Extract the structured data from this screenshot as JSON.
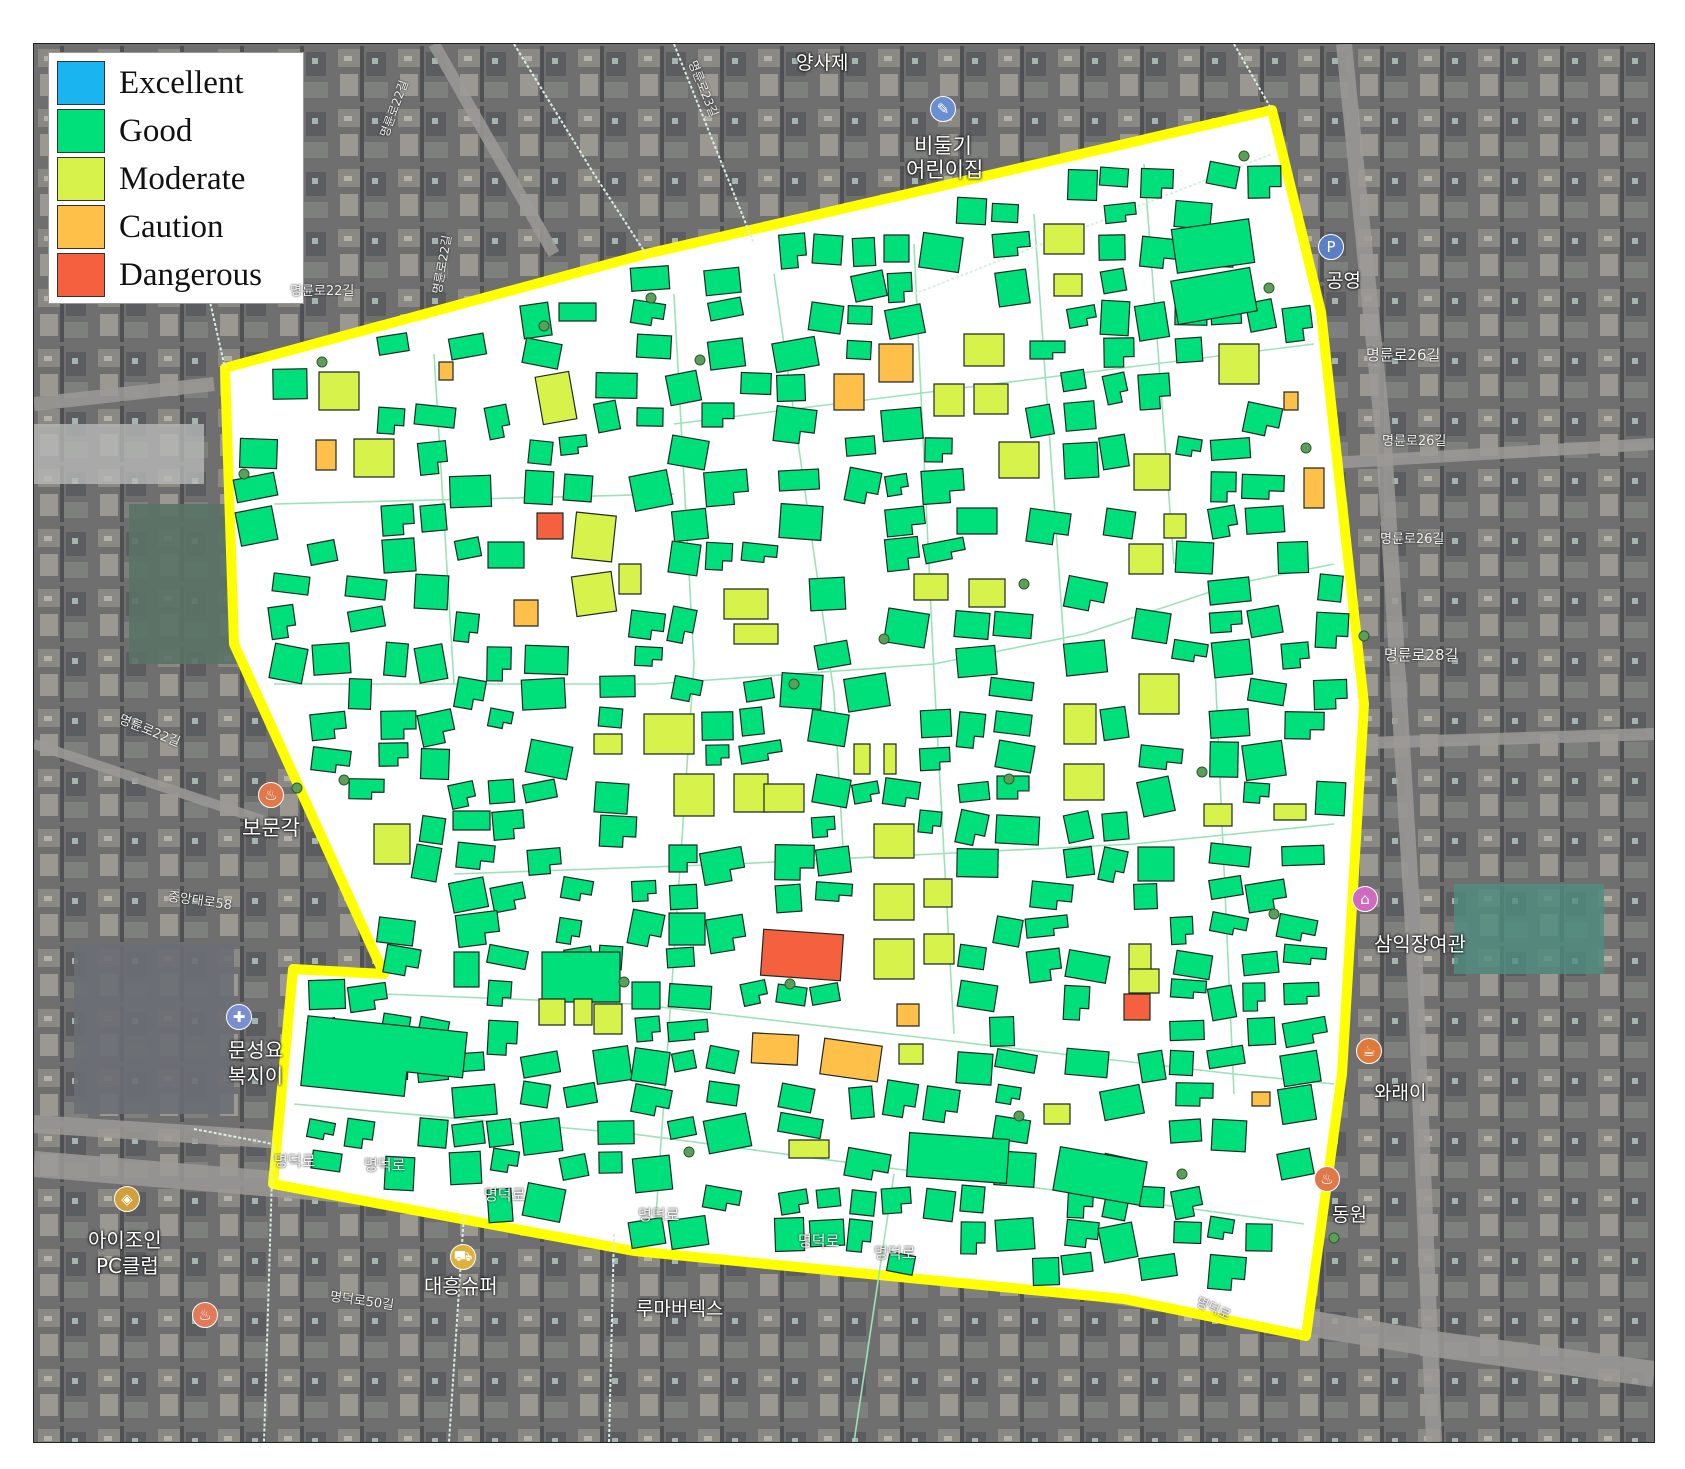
{
  "map": {
    "legend": {
      "items": [
        {
          "label": "Excellent",
          "color": "#1ab4f0"
        },
        {
          "label": "Good",
          "color": "#00e07a"
        },
        {
          "label": "Moderate",
          "color": "#d6f24b"
        },
        {
          "label": "Caution",
          "color": "#ffc04a"
        },
        {
          "label": "Dangerous",
          "color": "#f5603e"
        }
      ]
    },
    "colors": {
      "boundary": "#ffff00",
      "study_area": "#ffffff",
      "road_lines": "#9ce2b8",
      "node_dots": "#5aa05a",
      "building_outline": "#1e2a22"
    },
    "place_labels": {
      "yangsaje": "양사제",
      "bidulgi": "비둘기",
      "eorinijip": "어린이집",
      "gongyeong": "공영",
      "bomungak": "보문각",
      "samik": "삼익장여관",
      "waraei": "와래이",
      "dongwon": "동원",
      "munseong": "문성요",
      "bokji": "복지이",
      "aijoin": "아이조인",
      "pcclub": "PC클럽",
      "daeheung": "대흥슈퍼",
      "rumabeotesu": "루마버텍스"
    },
    "street_labels": {
      "myeongryun26a": "명륜로26길",
      "myeongryun26b": "명륜로26길",
      "myeongryun26c": "명륜로26길",
      "myeongryun28": "명륜로28길",
      "myeongryun22a": "명륜로22길",
      "myeongryun22b": "명륜로22길",
      "myeongryun22c": "명륜로22길",
      "myeongryun22d": "명륜로22길",
      "myeongryun23": "명륜로23길",
      "jungang": "중앙대로58",
      "myeongdeok1": "명덕로",
      "myeongdeok2": "명덕로",
      "myeongdeok3": "명덕로",
      "myeongdeok4": "명덕로",
      "myeongdeok5": "명덕로",
      "myeongdeok6": "명덕로",
      "myeongdeok50": "명덕로50길",
      "myeongdeok_right": "명덕로"
    },
    "poi_icons": [
      {
        "name": "parking-icon",
        "glyph": "P"
      },
      {
        "name": "school-icon",
        "glyph": "✎"
      },
      {
        "name": "restaurant-icon",
        "glyph": "♨"
      },
      {
        "name": "hotel-icon",
        "glyph": "⌂"
      },
      {
        "name": "cafe-icon",
        "glyph": "☕"
      },
      {
        "name": "shop-icon",
        "glyph": "⛟"
      },
      {
        "name": "medical-icon",
        "glyph": "✚"
      },
      {
        "name": "store-icon",
        "glyph": "◈"
      }
    ],
    "building_categories": {
      "good": 520,
      "moderate": 55,
      "caution": 14,
      "dangerous": 4
    }
  }
}
